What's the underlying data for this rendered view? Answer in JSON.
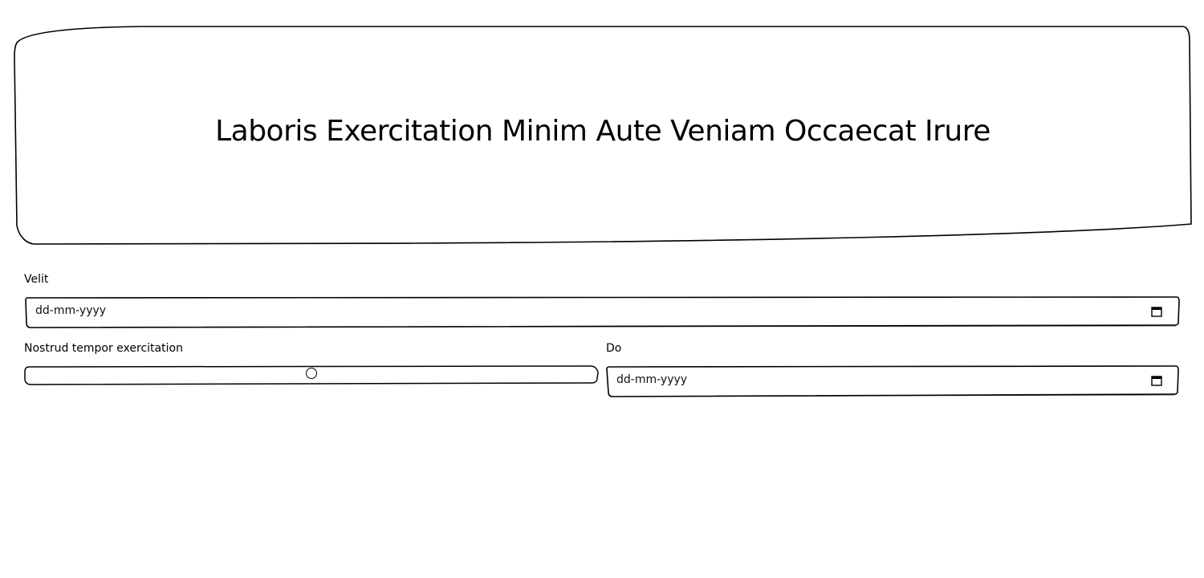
{
  "hero": {
    "title": "Laboris Exercitation Minim Aute Veniam Occaecat Irure"
  },
  "form": {
    "field_velit": {
      "label": "Velit",
      "placeholder": "dd-mm-yyyy",
      "icon": "calendar-icon"
    },
    "field_nostrud": {
      "label": "Nostrud tempor exercitation",
      "value_fraction": 0.5
    },
    "field_do": {
      "label": "Do",
      "placeholder": "dd-mm-yyyy",
      "icon": "calendar-icon"
    }
  }
}
